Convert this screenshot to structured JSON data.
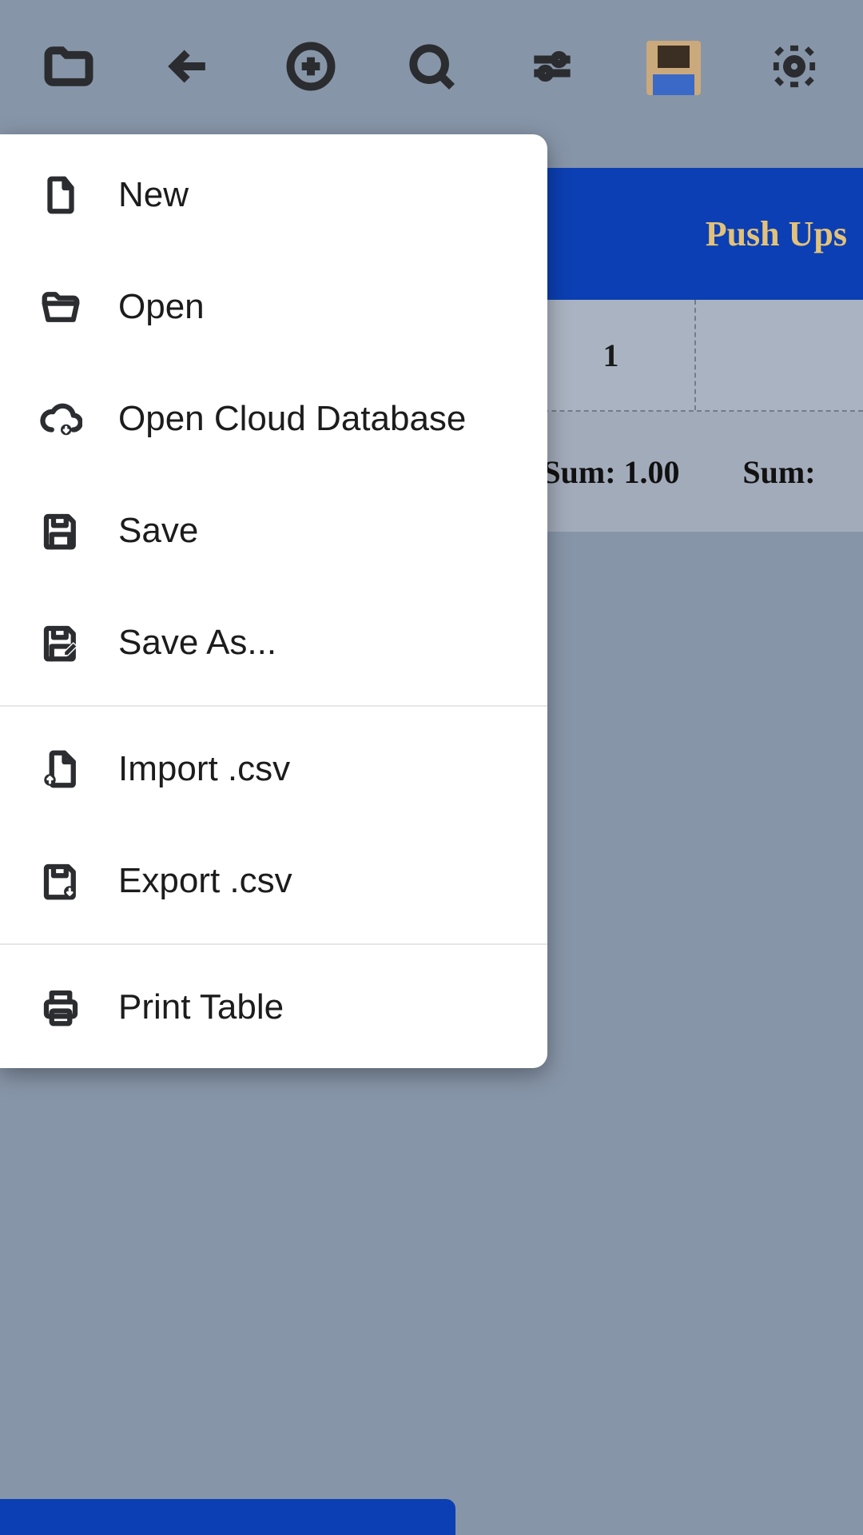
{
  "table": {
    "header": "Push Ups",
    "cell_value": "1",
    "sum_left": "Sum: 1.00",
    "sum_right": "Sum:"
  },
  "menu": {
    "new": "New",
    "open": "Open",
    "open_cloud": "Open Cloud Database",
    "save": "Save",
    "save_as": "Save As...",
    "import_csv": "Import .csv",
    "export_csv": "Export .csv",
    "print_table": "Print Table"
  }
}
